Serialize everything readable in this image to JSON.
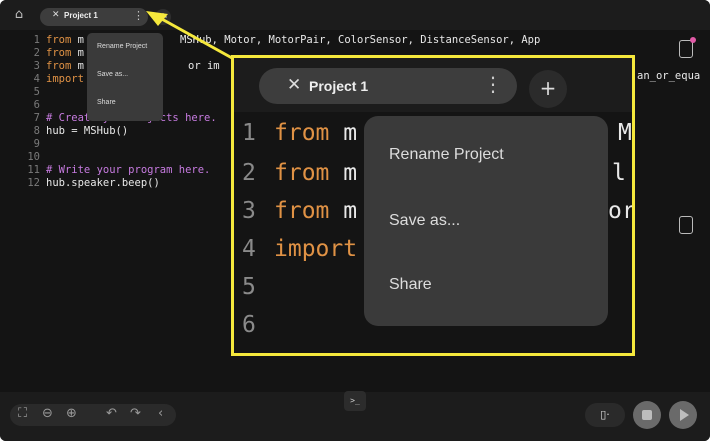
{
  "tabbar": {
    "tab_title": "Project 1",
    "close_glyph": "✕",
    "more_glyph": "⋮",
    "add_glyph": "+",
    "home_glyph": "⌂"
  },
  "menu": {
    "items": [
      "Rename Project",
      "Save as...",
      "Share"
    ]
  },
  "code": {
    "lines": [
      {
        "n": "1",
        "kw": "from",
        "text": " m"
      },
      {
        "n": "2",
        "kw": "from",
        "text": " m"
      },
      {
        "n": "3",
        "kw": "from",
        "text": " m"
      },
      {
        "n": "4",
        "kw": "import",
        "text": ""
      },
      {
        "n": "5",
        "kw": "",
        "text": ""
      },
      {
        "n": "6",
        "kw": "",
        "text": ""
      },
      {
        "n": "7",
        "kw": "",
        "text": "",
        "comment": "# Create your objects here."
      },
      {
        "n": "8",
        "kw": "",
        "text": "hub = MSHub()"
      },
      {
        "n": "9",
        "kw": "",
        "text": ""
      },
      {
        "n": "10",
        "kw": "",
        "text": ""
      },
      {
        "n": "11",
        "kw": "",
        "text": "",
        "comment": "# Write your program here."
      },
      {
        "n": "12",
        "kw": "",
        "text": "hub.speaker.beep()"
      }
    ],
    "line1_tail": "MSHub, Motor, MotorPair, ColorSensor, DistanceSensor, App",
    "line3_tail": "or im",
    "line3_right": "an_or_equa"
  },
  "callout": {
    "tab_title": "Project 1",
    "menu_items": [
      "Rename Project",
      "Save as...",
      "Share"
    ],
    "lines": [
      {
        "n": "1",
        "kw": "from",
        "text": " m",
        "tail": "M"
      },
      {
        "n": "2",
        "kw": "from",
        "text": " m",
        "tail": "l"
      },
      {
        "n": "3",
        "kw": "from",
        "text": " m",
        "tail": "or"
      },
      {
        "n": "4",
        "kw": "import",
        "text": "",
        "tail": ""
      },
      {
        "n": "5",
        "kw": "",
        "text": "",
        "tail": ""
      },
      {
        "n": "6",
        "kw": "",
        "text": "",
        "tail": ""
      }
    ]
  },
  "bottom": {
    "terminal_glyph": ">_",
    "zoom_glyphs": [
      "⛶",
      "⊖",
      "⊕",
      "↶",
      "↷",
      "‹"
    ],
    "device_glyph": "▯·"
  },
  "colors": {
    "highlight": "#f5e83c",
    "keyword": "#e09245",
    "comment": "#c77be0",
    "notification": "#e05aa6"
  }
}
